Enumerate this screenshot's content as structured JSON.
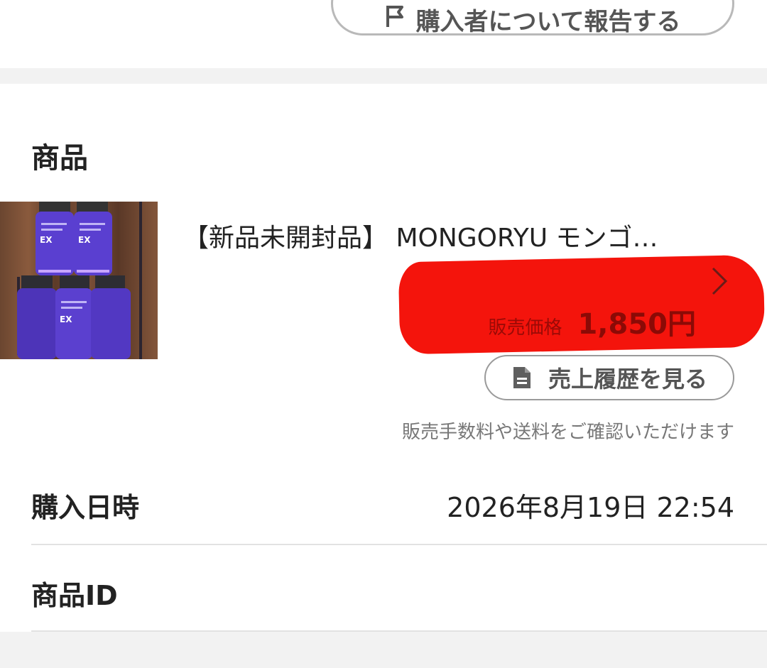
{
  "top_button": {
    "label": "購入者について報告する",
    "icon": "flag-icon"
  },
  "section": {
    "title": "商品"
  },
  "product": {
    "name": "【新品未開封品】 MONGORYU モンゴ…",
    "price_label": "販売価格",
    "price_value": "1,850円",
    "image_text": "EX"
  },
  "sales_history": {
    "label": "売上履歴を見る",
    "icon": "document-icon"
  },
  "fee_note": "販売手数料や送料をご確認いただけます",
  "details": {
    "purchase_date_label": "購入日時",
    "purchase_date_value": "2026年8月19日 22:54",
    "item_id_label": "商品ID"
  },
  "colors": {
    "redaction": "#f4140c",
    "band": "#f2f2f2",
    "border": "#9a9a9a",
    "text": "#222222",
    "muted": "#777777"
  }
}
